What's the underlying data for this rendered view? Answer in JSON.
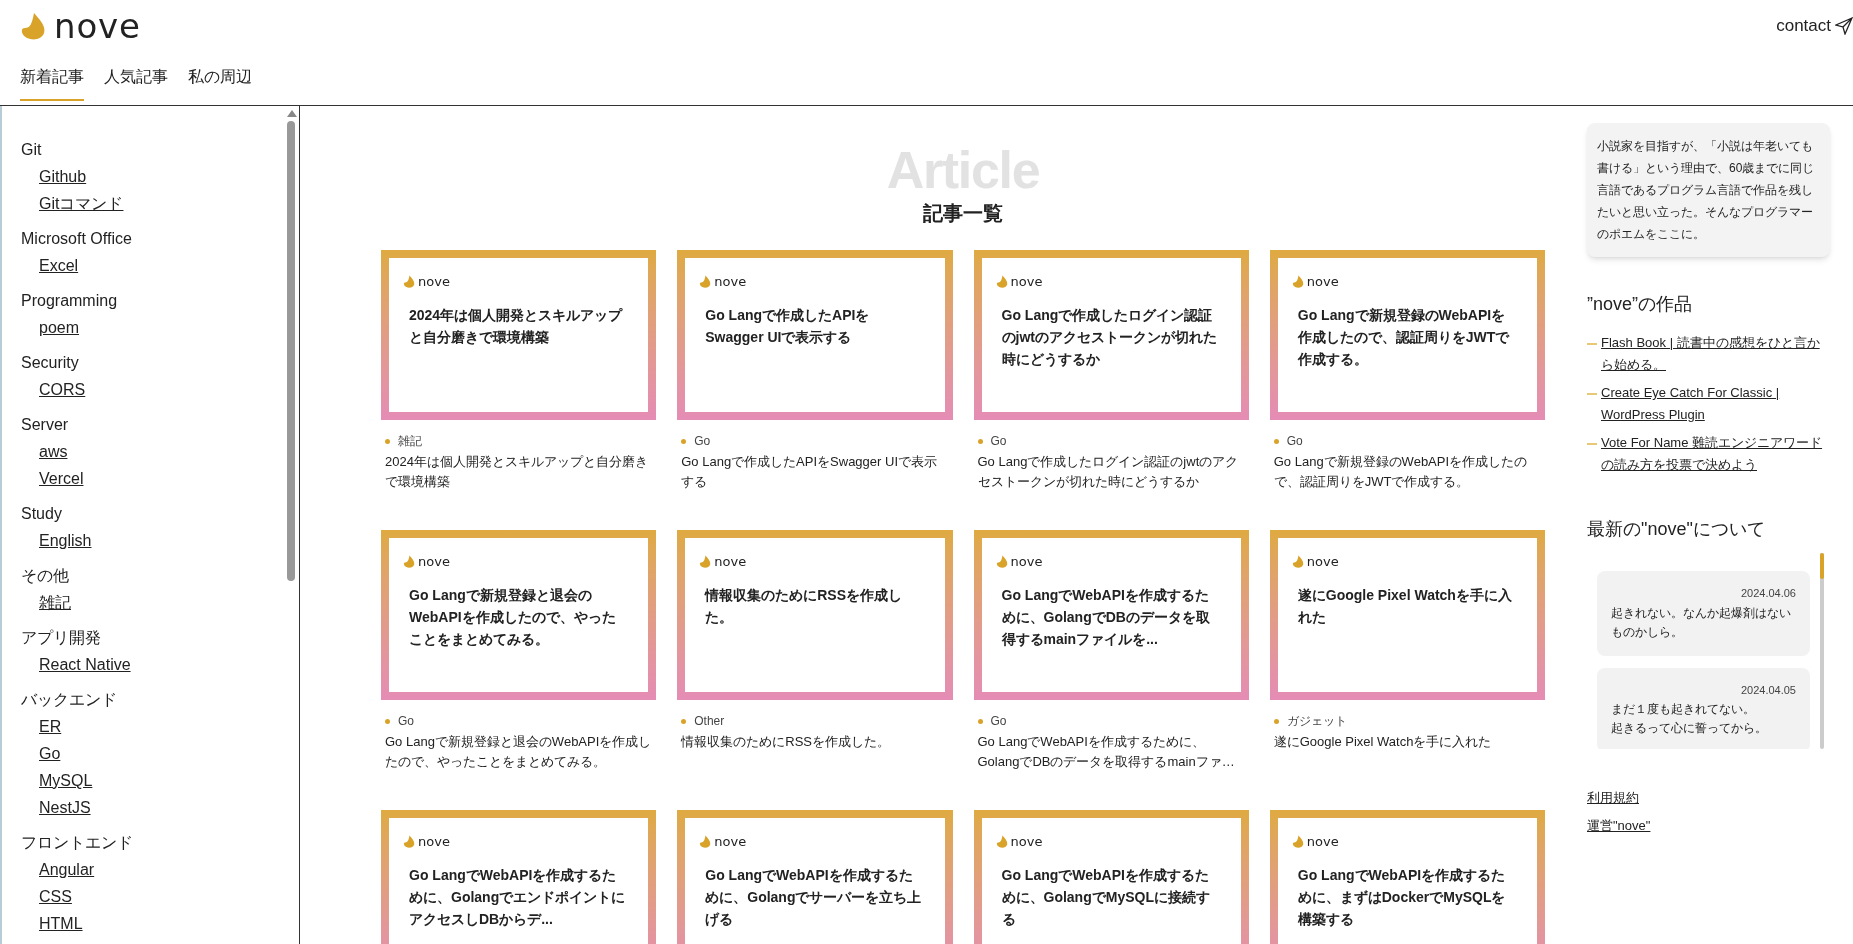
{
  "site": {
    "logo": "nove",
    "contact": "contact"
  },
  "tabs": [
    {
      "label": "新着記事",
      "selected": true
    },
    {
      "label": "人気記事",
      "selected": false
    },
    {
      "label": "私の周辺",
      "selected": false
    }
  ],
  "sidebar": {
    "groups": [
      {
        "heading": "Git",
        "links": [
          "Github",
          "Gitコマンド"
        ]
      },
      {
        "heading": "Microsoft Office",
        "links": [
          "Excel"
        ]
      },
      {
        "heading": "Programming",
        "links": [
          "poem"
        ]
      },
      {
        "heading": "Security",
        "links": [
          "CORS"
        ]
      },
      {
        "heading": "Server",
        "links": [
          "aws",
          "Vercel"
        ]
      },
      {
        "heading": "Study",
        "links": [
          "English"
        ]
      },
      {
        "heading": "その他",
        "links": [
          "雑記"
        ]
      },
      {
        "heading": "アプリ開発",
        "links": [
          "React Native"
        ]
      },
      {
        "heading": "バックエンド",
        "links": [
          "ER",
          "Go",
          "MySQL",
          "NestJS"
        ]
      },
      {
        "heading": "フロントエンド",
        "links": [
          "Angular",
          "CSS",
          "HTML"
        ]
      }
    ]
  },
  "main": {
    "watermark": "Article",
    "heading": "記事一覧",
    "articles": [
      {
        "brand": "nove",
        "title": "2024年は個人開発とスキルアップと自分磨きで環境構築",
        "category": "雑記",
        "excerpt": "2024年は個人開発とスキルアップと自分磨きで環境構築"
      },
      {
        "brand": "nove",
        "title": "Go Langで作成したAPIをSwagger UIで表示する",
        "category": "Go",
        "excerpt": "Go Langで作成したAPIをSwagger UIで表示する"
      },
      {
        "brand": "nove",
        "title": "Go Langで作成したログイン認証のjwtのアクセストークンが切れた時にどうするか",
        "category": "Go",
        "excerpt": "Go Langで作成したログイン認証のjwtのアクセストークンが切れた時にどうするか"
      },
      {
        "brand": "nove",
        "title": "Go Langで新規登録のWebAPIを作成したので、認証周りをJWTで作成する。",
        "category": "Go",
        "excerpt": "Go Langで新規登録のWebAPIを作成したので、認証周りをJWTで作成する。"
      },
      {
        "brand": "nove",
        "title": "Go Langで新規登録と退会のWebAPIを作成したので、やったことをまとめてみる。",
        "category": "Go",
        "excerpt": "Go Langで新規登録と退会のWebAPIを作成したので、やったことをまとめてみる。"
      },
      {
        "brand": "nove",
        "title": "情報収集のためにRSSを作成した。",
        "category": "Other",
        "excerpt": "情報収集のためにRSSを作成した。"
      },
      {
        "brand": "nove",
        "title": "Go LangでWebAPIを作成するために、GolangでDBのデータを取得するmainファイルを...",
        "category": "Go",
        "excerpt": "Go LangでWebAPIを作成するために、GolangでDBのデータを取得するmainファ…"
      },
      {
        "brand": "nove",
        "title": "遂にGoogle Pixel Watchを手に入れた",
        "category": "ガジェット",
        "excerpt": "遂にGoogle Pixel Watchを手に入れた"
      },
      {
        "brand": "nove",
        "title": "Go LangでWebAPIを作成するために、GolangでエンドポイントにアクセスしDBからデ..."
      },
      {
        "brand": "nove",
        "title": "Go LangでWebAPIを作成するために、Golangでサーバーを立ち上げる"
      },
      {
        "brand": "nove",
        "title": "Go LangでWebAPIを作成するために、GolangでMySQLに接続する"
      },
      {
        "brand": "nove",
        "title": "Go LangでWebAPIを作成するために、まずはDockerでMySQLを構築する"
      }
    ]
  },
  "aside": {
    "intro": "小説家を目指すが、「小説は年老いても書ける」という理由で、60歳までに同じ言語であるプログラム言語で作品を残したいと思い立った。そんなプログラマーのポエムをここに。",
    "works_heading": "”nove”の作品",
    "works": [
      "Flash Book | 読書中の感想をひと言から始める。",
      "Create Eye Catch For Classic | WordPress Plugin",
      "Vote For Name 難読エンジニアワードの読み方を投票で決めよう"
    ],
    "news_heading": "最新の\"nove\"について",
    "news": [
      {
        "date": "2024.04.06",
        "text": "起きれない。なんか起爆剤はないものかしら。"
      },
      {
        "date": "2024.04.05",
        "lines": [
          "まだ１度も起きれてない。",
          "起きるって心に誓ってから。"
        ]
      }
    ],
    "footer_links": [
      "利用規約",
      "運営\"nove\""
    ]
  }
}
